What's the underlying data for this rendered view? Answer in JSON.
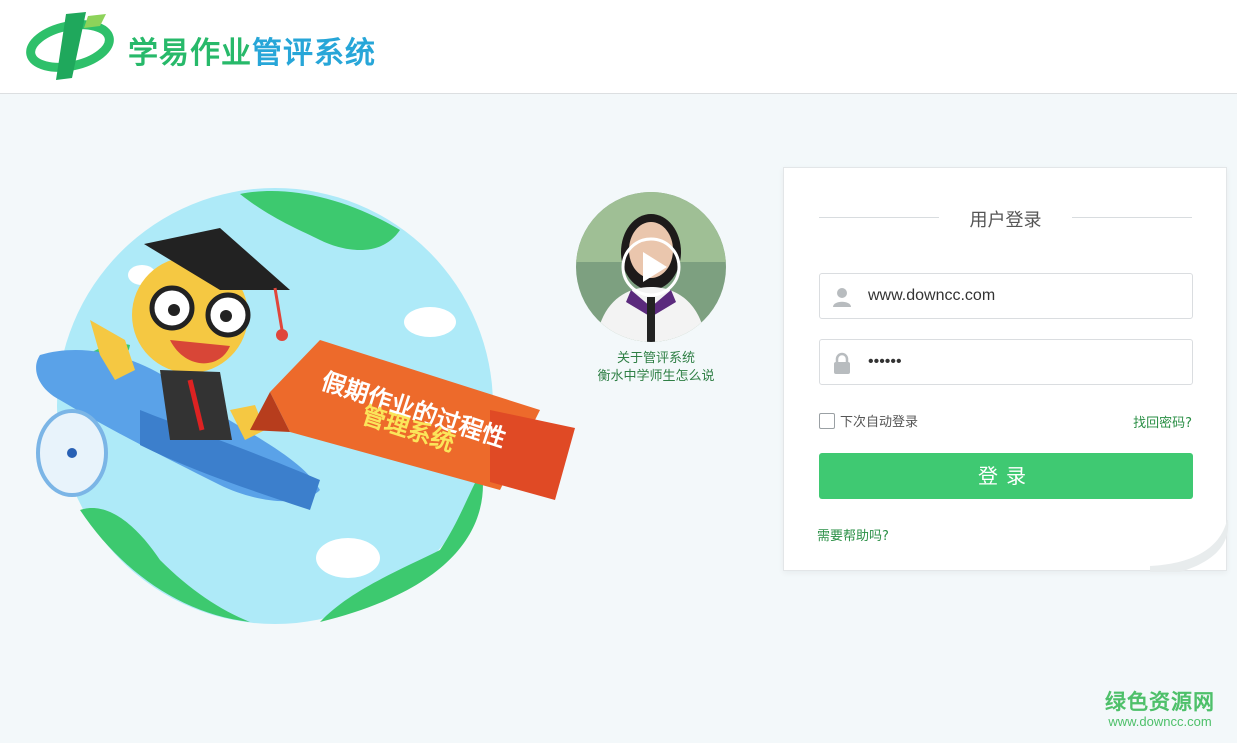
{
  "header": {
    "app_name_part1": "学易作业",
    "app_name_part2": "管评系统"
  },
  "banner": {
    "ribbon_line1": "假期作业的过程性",
    "ribbon_line2": "管理系统"
  },
  "video": {
    "caption_line1": "关于管评系统",
    "caption_line2": "衡水中学师生怎么说"
  },
  "login": {
    "title": "用户登录",
    "username_value": "www.downcc.com",
    "password_value": "••••••",
    "remember_label": "下次自动登录",
    "forgot_link": "找回密码?",
    "submit_label": "登录",
    "help_link": "需要帮助吗?"
  },
  "watermark": {
    "name": "绿色资源网",
    "url": "www.downcc.com"
  },
  "colors": {
    "brand_green": "#3fc972",
    "link_green": "#2a8f45",
    "brand_blue": "#27a6d8",
    "background": "#f3f8fa"
  },
  "icons": {
    "logo": "logo-mark",
    "user_field": "user-icon",
    "password_field": "lock-icon",
    "video": "play-icon"
  }
}
